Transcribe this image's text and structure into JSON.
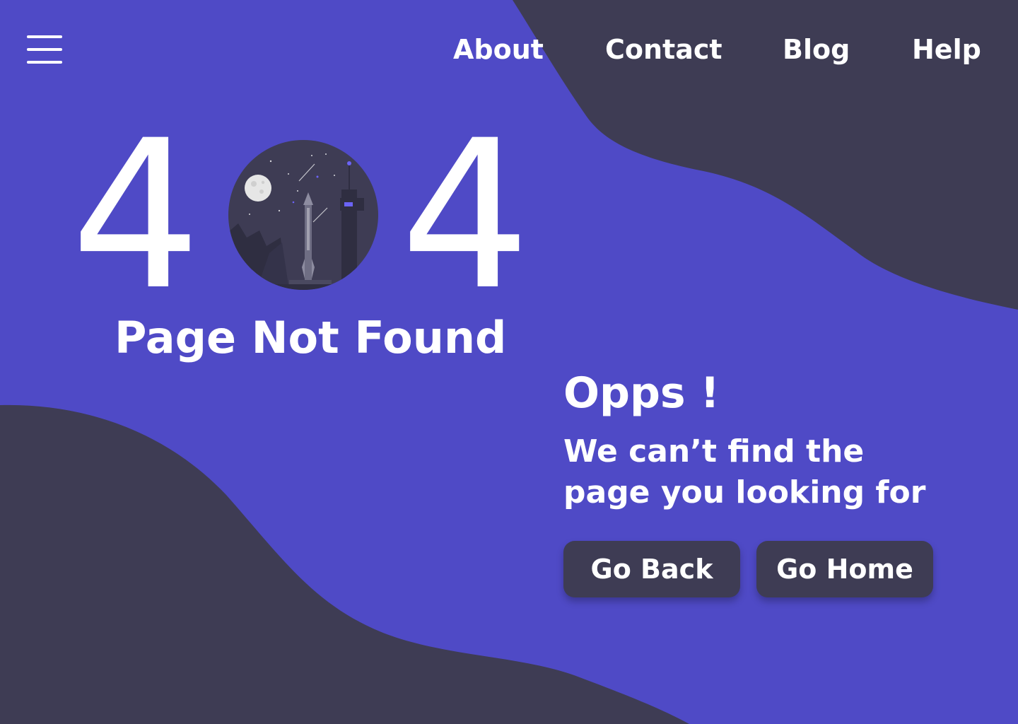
{
  "nav": {
    "menu_icon": "hamburger-menu-icon",
    "links": [
      {
        "label": "About"
      },
      {
        "label": "Contact"
      },
      {
        "label": "Blog"
      },
      {
        "label": "Help"
      }
    ]
  },
  "hero": {
    "code_left": "4",
    "code_right": "4",
    "code_middle_icon": "rocket-launch-night-scene-icon",
    "title": "Page Not Found"
  },
  "message": {
    "heading": "Opps !",
    "body": "We can’t find the page you looking for"
  },
  "actions": {
    "go_back": "Go Back",
    "go_home": "Go Home"
  },
  "colors": {
    "background": "#4f4ac6",
    "blob": "#3e3c54",
    "text": "#ffffff",
    "button": "#3e3c54",
    "accent": "#6b63f5"
  }
}
